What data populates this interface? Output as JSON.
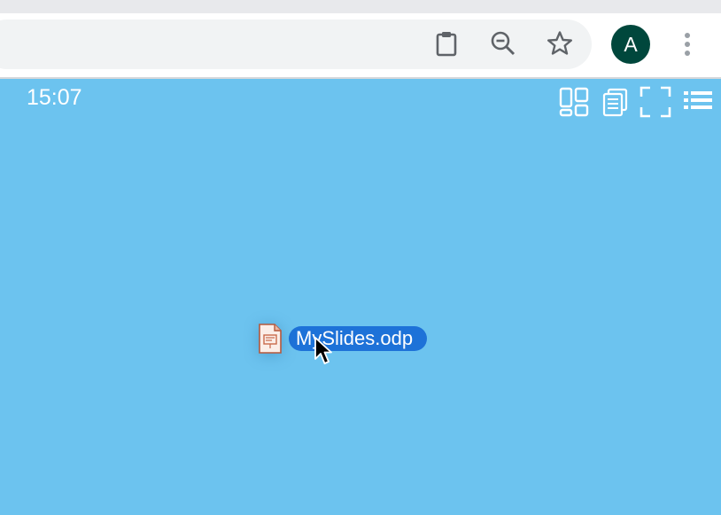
{
  "browser": {
    "toolbar_icons": [
      "clipboard-icon",
      "zoom-out-icon",
      "bookmark-star-icon"
    ],
    "profile_initial": "A",
    "profile_color": "#00473c",
    "menu_icon": "more-vert-icon"
  },
  "desktop": {
    "background_color": "#6cc3ef",
    "clock": "15:07",
    "top_right_icons": [
      "grid-view-icon",
      "copy-icon",
      "fullscreen-icon",
      "list-view-icon"
    ],
    "file": {
      "name": "MySlides.odp",
      "icon": "presentation-file-icon",
      "selected": true,
      "selection_color": "#1d72d8"
    },
    "cursor": "arrow-cursor"
  }
}
